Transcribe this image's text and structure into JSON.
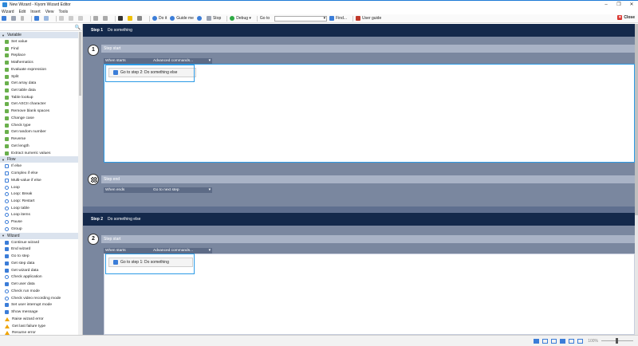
{
  "window": {
    "title": "New Wizard - Kiyom Wizard Editor"
  },
  "menu": [
    "Wizard",
    "Edit",
    "Insert",
    "View",
    "Tools"
  ],
  "toolbar": {
    "do_it": "Do it",
    "guide_me": "Guide me",
    "stop": "Stop",
    "debug": "Debug",
    "go_to": "Go to",
    "find": "Find...",
    "user_guide": "User guide",
    "close": "Close"
  },
  "sidebar": {
    "categories": [
      {
        "label": "Variable",
        "items": [
          {
            "label": "Set value",
            "icon": "var-icon"
          },
          {
            "label": "Find",
            "icon": "var-icon"
          },
          {
            "label": "Replace",
            "icon": "var-icon"
          },
          {
            "label": "Mathematics",
            "icon": "var-icon"
          },
          {
            "label": "Evaluate expression",
            "icon": "var-icon"
          },
          {
            "label": "Split",
            "icon": "var-icon"
          },
          {
            "label": "Get array data",
            "icon": "var-icon"
          },
          {
            "label": "Get table data",
            "icon": "var-icon"
          },
          {
            "label": "Table lookup",
            "icon": "var-icon"
          },
          {
            "label": "Get ASCII character",
            "icon": "var-icon"
          },
          {
            "label": "Remove blank spaces",
            "icon": "var-icon"
          },
          {
            "label": "Change case",
            "icon": "var-icon"
          },
          {
            "label": "Check type",
            "icon": "var-icon"
          },
          {
            "label": "Get random number",
            "icon": "var-icon"
          },
          {
            "label": "Reverse",
            "icon": "var-icon"
          },
          {
            "label": "Get length",
            "icon": "var-icon"
          },
          {
            "label": "Extract numeric values",
            "icon": "var-icon"
          }
        ]
      },
      {
        "label": "Flow",
        "items": [
          {
            "label": "If else",
            "icon": "flow-icon"
          },
          {
            "label": "Complex if else",
            "icon": "flow-icon"
          },
          {
            "label": "Multi-value if else",
            "icon": "flow-icon"
          },
          {
            "label": "Loop",
            "icon": "loop-icon"
          },
          {
            "label": "Loop: Break",
            "icon": "loop-icon"
          },
          {
            "label": "Loop: Restart",
            "icon": "loop-icon"
          },
          {
            "label": "Loop table",
            "icon": "loop-icon"
          },
          {
            "label": "Loop items",
            "icon": "loop-icon"
          },
          {
            "label": "Pause",
            "icon": "loop-icon"
          },
          {
            "label": "Group",
            "icon": "loop-icon"
          }
        ]
      },
      {
        "label": "Wizard",
        "items": [
          {
            "label": "Continue wizard",
            "icon": "wizard-icon"
          },
          {
            "label": "End wizard",
            "icon": "wizard-icon"
          },
          {
            "label": "Go to step",
            "icon": "wizard-icon"
          },
          {
            "label": "Get step data",
            "icon": "wizard-icon"
          },
          {
            "label": "Get wizard data",
            "icon": "wizard-icon"
          },
          {
            "label": "Check application",
            "icon": "loop-icon"
          },
          {
            "label": "Get user data",
            "icon": "wizard-icon"
          },
          {
            "label": "Check run mode",
            "icon": "loop-icon"
          },
          {
            "label": "Check video recording mode",
            "icon": "loop-icon"
          },
          {
            "label": "Set user interrupt mode",
            "icon": "wizard-icon"
          },
          {
            "label": "Show message",
            "icon": "wizard-icon"
          },
          {
            "label": "Raise wizard error",
            "icon": "warning-icon"
          },
          {
            "label": "Get last failure type",
            "icon": "warning-icon"
          },
          {
            "label": "Resume error",
            "icon": "warning-icon"
          }
        ]
      }
    ]
  },
  "steps": [
    {
      "number_label": "Step 1",
      "name": "Do something",
      "badge": "1",
      "start_label": "Step start",
      "start_condition": "When starts",
      "start_select": "Advanced commands...",
      "action": "Go to step 2: Do something else",
      "end_label": "Step end",
      "end_condition": "When ends",
      "end_select": "Go to next step"
    },
    {
      "number_label": "Step 2",
      "name": "Do something else",
      "badge": "2",
      "start_label": "Step start",
      "start_condition": "When starts",
      "start_select": "Advanced commands...",
      "action": "Go to step 1: Do something"
    }
  ],
  "status": {
    "zoom": "100%"
  }
}
